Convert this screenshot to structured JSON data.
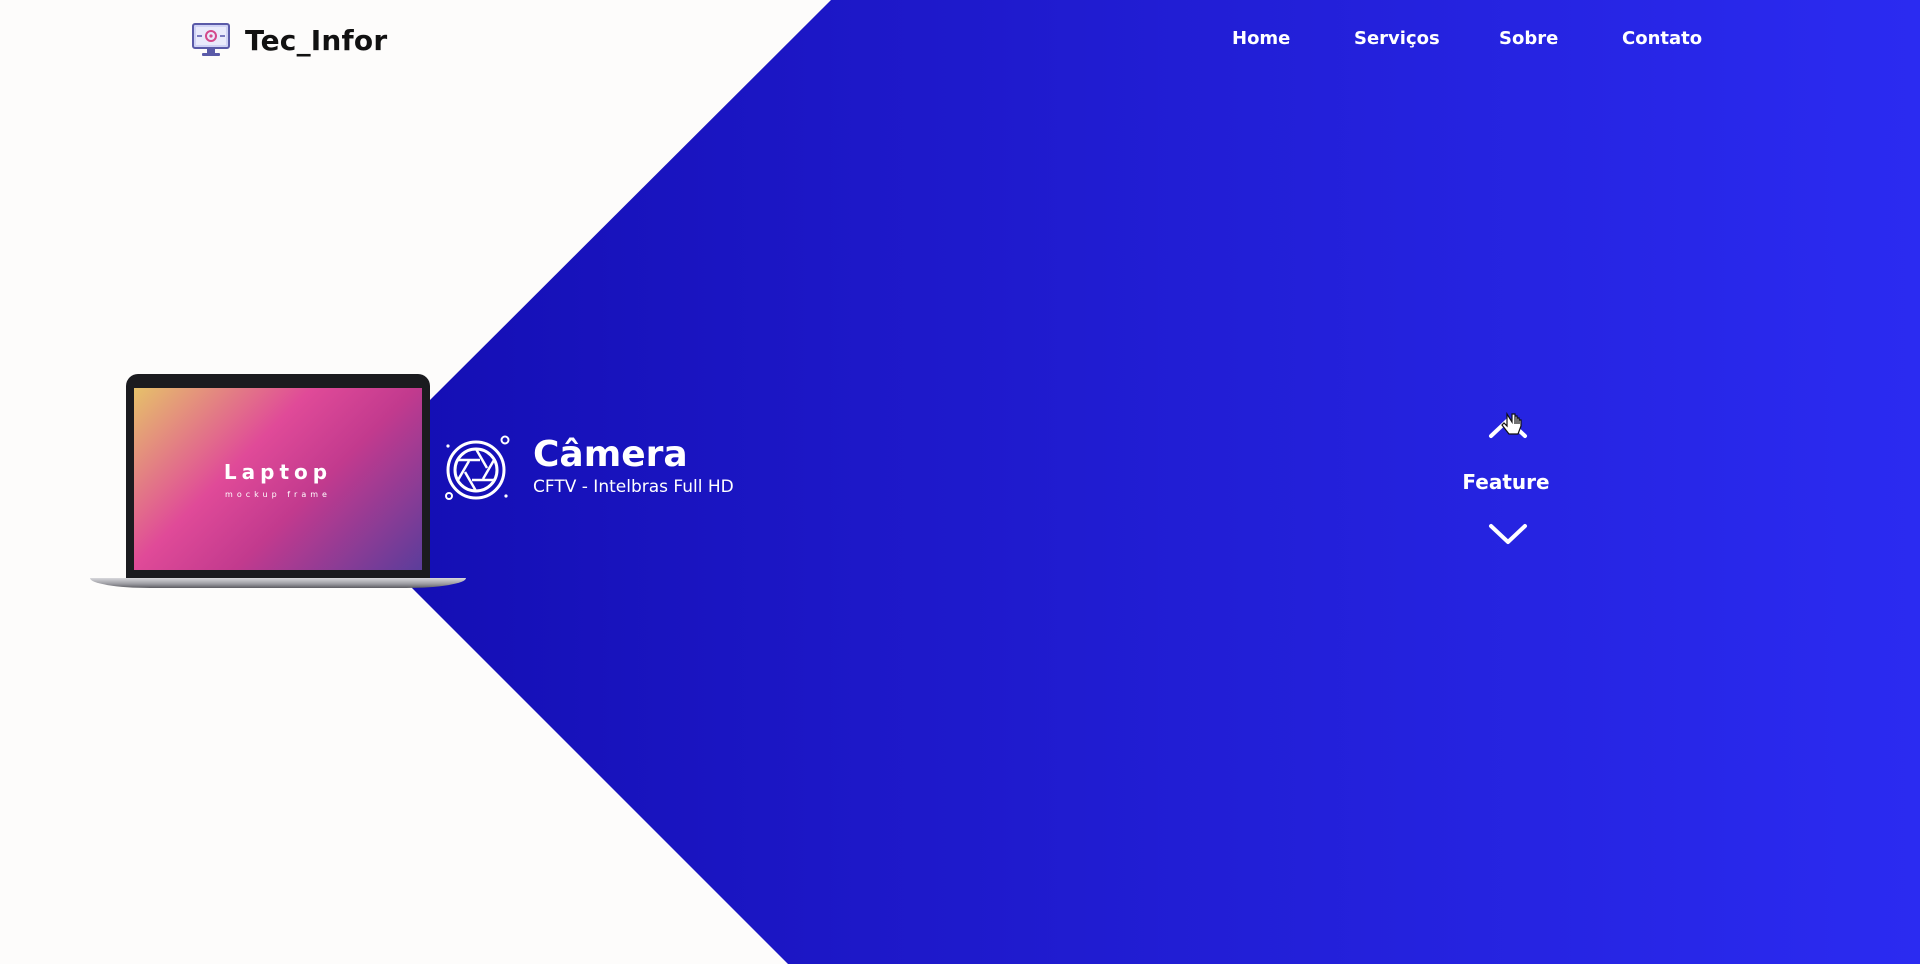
{
  "brand": {
    "logo_icon": "computer-gear-icon",
    "name": "Tec_Infor"
  },
  "nav": {
    "items": [
      {
        "label": "Home"
      },
      {
        "label": "Serviços"
      },
      {
        "label": "Sobre"
      },
      {
        "label": "Contato"
      }
    ]
  },
  "hero": {
    "laptop": {
      "screen_title": "Laptop",
      "screen_subtitle": "mockup frame"
    },
    "feature": {
      "icon": "camera-shutter-icon",
      "title": "Câmera",
      "subtitle": "CFTV - Intelbras Full HD"
    },
    "scroller": {
      "up_icon": "chevron-up-icon",
      "label": "Feature",
      "down_icon": "chevron-down-icon"
    }
  },
  "colors": {
    "gradient_start": "#0c06a2",
    "gradient_end": "#2b2bf1",
    "page_background": "#fdfcfb"
  }
}
